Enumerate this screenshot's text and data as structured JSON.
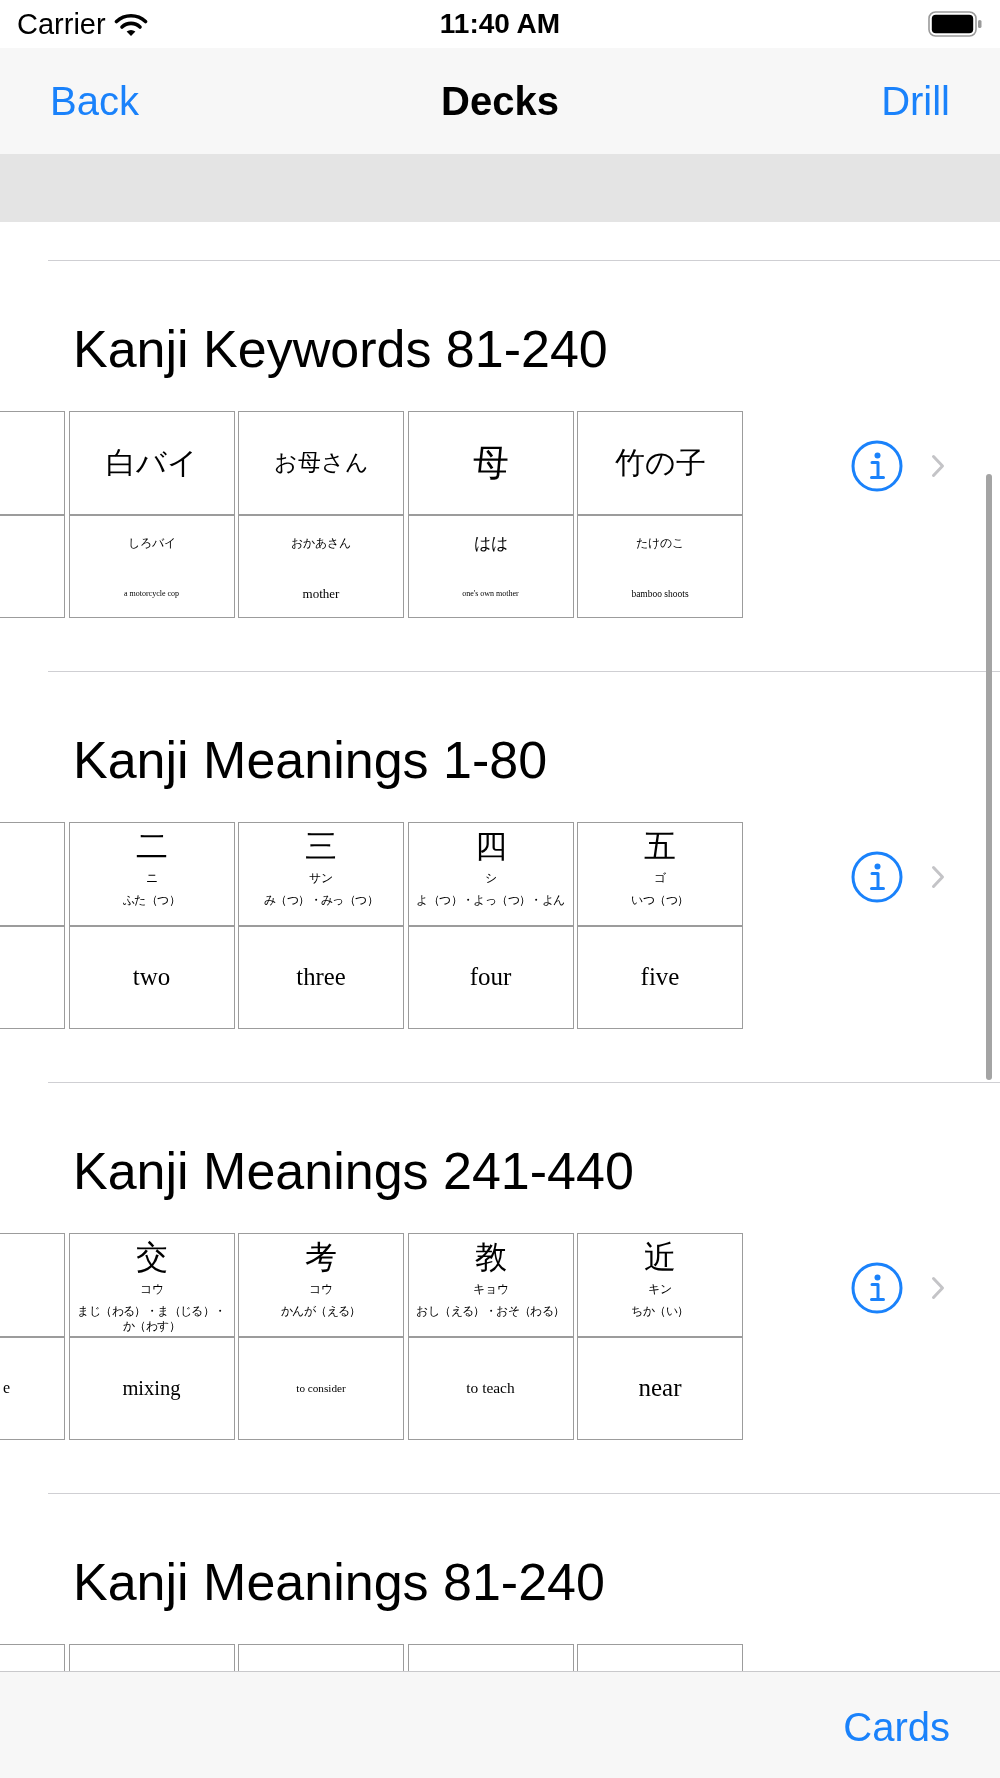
{
  "status_bar": {
    "carrier": "Carrier",
    "time": "11:40 AM"
  },
  "nav_bar": {
    "back": "Back",
    "title": "Decks",
    "action": "Drill"
  },
  "decks": [
    {
      "title": "Kanji Keywords 81-240",
      "cards": [
        {
          "kind": "cut"
        },
        {
          "kind": "keyword",
          "front": "白バイ",
          "reading": "しろバイ",
          "meaning": "a motorcycle cop"
        },
        {
          "kind": "keyword",
          "front": "お母さん",
          "reading": "おかあさん",
          "meaning": "mother"
        },
        {
          "kind": "keyword",
          "front": "母",
          "reading": "はは",
          "meaning": "one's own mother"
        },
        {
          "kind": "keyword",
          "front": "竹の子",
          "reading": "たけのこ",
          "meaning": "bamboo shoots"
        }
      ]
    },
    {
      "title": "Kanji Meanings 1-80",
      "cards": [
        {
          "kind": "cut"
        },
        {
          "kind": "kanji",
          "front": "二",
          "on": "ニ",
          "kun": "ふた（つ）",
          "meaning": "two"
        },
        {
          "kind": "kanji",
          "front": "三",
          "on": "サン",
          "kun": "み（つ）・みっ（つ）",
          "meaning": "three"
        },
        {
          "kind": "kanji",
          "front": "四",
          "on": "シ",
          "kun": "よ（つ）・よっ（つ）・よん",
          "meaning": "four"
        },
        {
          "kind": "kanji",
          "front": "五",
          "on": "ゴ",
          "kun": "いつ（つ）",
          "meaning": "five"
        }
      ]
    },
    {
      "title": "Kanji Meanings 241-440",
      "cards": [
        {
          "kind": "cut",
          "meaning": "e"
        },
        {
          "kind": "kanji",
          "front": "交",
          "on": "コウ",
          "kun": "まじ（わる）・ま（じる）・か（わす）",
          "meaning": "mixing"
        },
        {
          "kind": "kanji",
          "front": "考",
          "on": "コウ",
          "kun": "かんが（える）",
          "meaning": "to consider"
        },
        {
          "kind": "kanji",
          "front": "教",
          "on": "キョウ",
          "kun": "おし（える）・おそ（わる）",
          "meaning": "to teach"
        },
        {
          "kind": "kanji",
          "front": "近",
          "on": "キン",
          "kun": "ちか（い）",
          "meaning": "near"
        }
      ]
    },
    {
      "title": "Kanji Meanings 81-240",
      "cards": [
        {
          "kind": "cut"
        },
        {
          "kind": "kanji"
        },
        {
          "kind": "kanji"
        },
        {
          "kind": "kanji"
        },
        {
          "kind": "kanji"
        }
      ]
    }
  ],
  "tab_bar": {
    "button": "Cards"
  }
}
